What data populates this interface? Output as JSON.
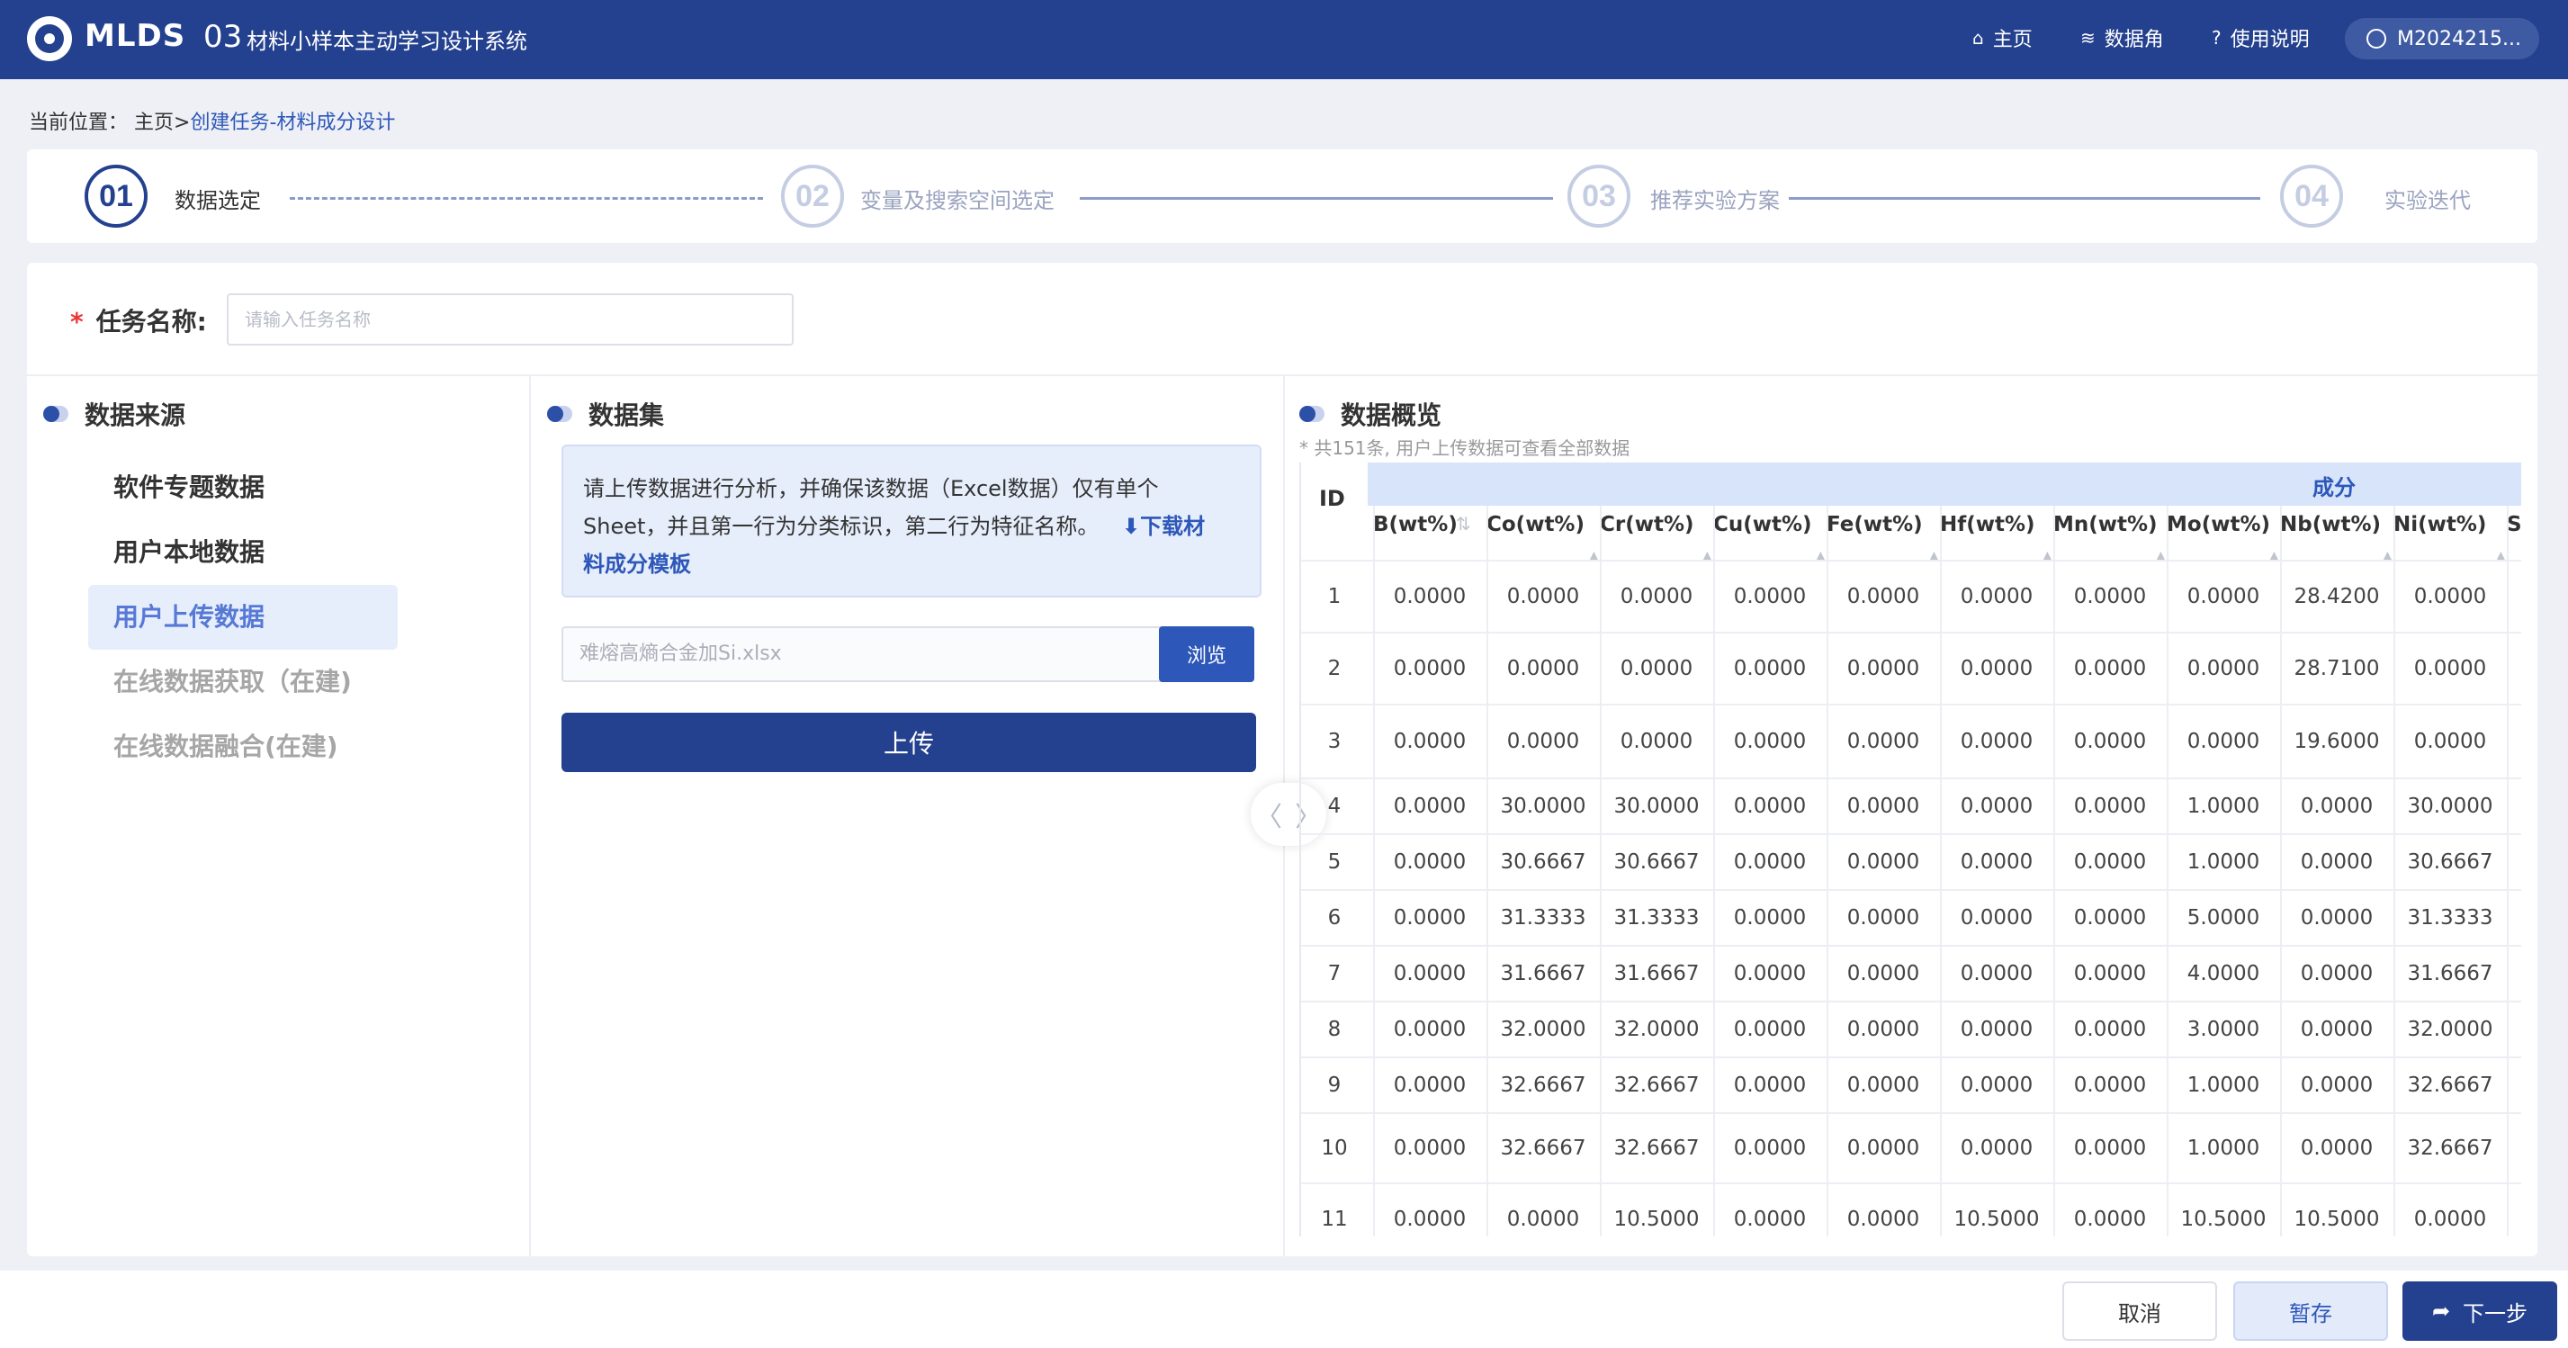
{
  "app": {
    "logo_text": "MLDS",
    "logo_num": "03",
    "title": "材料小样本主动学习设计系统"
  },
  "nav": {
    "home": "主页",
    "data_corner": "数据角",
    "help": "使用说明",
    "user": "M2024215..."
  },
  "breadcrumb": {
    "prefix": "当前位置：",
    "home": "主页>",
    "current": "创建任务-材料成分设计"
  },
  "steps": [
    {
      "num": "01",
      "label": "数据选定"
    },
    {
      "num": "02",
      "label": "变量及搜索空间选定"
    },
    {
      "num": "03",
      "label": "推荐实验方案"
    },
    {
      "num": "04",
      "label": "实验迭代"
    }
  ],
  "task": {
    "required_mark": "*",
    "label": "任务名称:",
    "placeholder": "请输入任务名称"
  },
  "data_source": {
    "title": "数据来源",
    "items": [
      {
        "label": "软件专题数据"
      },
      {
        "label": "用户本地数据"
      },
      {
        "label": "用户上传数据"
      },
      {
        "label": "在线数据获取（在建)"
      },
      {
        "label": "在线数据融合(在建)"
      }
    ]
  },
  "dataset": {
    "title": "数据集",
    "notice_line1": "请上传数据进行分析，并确保该数据（Excel数据）仅有单个",
    "notice_line2": "Sheet，并且第一行为分类标识，第二行为特征名称。",
    "download_label_1": "⬇下载材",
    "download_label_2": "料成分模板",
    "file_name": "难熔高熵合金加Si.xlsx",
    "browse_label": "浏览",
    "upload_label": "上传"
  },
  "overview": {
    "title": "数据概览",
    "note": "* 共151条, 用户上传数据可查看全部数据",
    "id_header": "ID",
    "group_header": "成分",
    "columns": [
      "B(wt%)",
      "Co(wt%)",
      "Cr(wt%)",
      "Cu(wt%)",
      "Fe(wt%)",
      "Hf(wt%)",
      "Mn(wt%)",
      "Mo(wt%)",
      "Nb(wt%)",
      "Ni(wt%)",
      "Si"
    ],
    "rows": [
      {
        "id": "1",
        "values": [
          "0.0000",
          "0.0000",
          "0.0000",
          "0.0000",
          "0.0000",
          "0.0000",
          "0.0000",
          "0.0000",
          "28.4200",
          "0.0000"
        ]
      },
      {
        "id": "2",
        "values": [
          "0.0000",
          "0.0000",
          "0.0000",
          "0.0000",
          "0.0000",
          "0.0000",
          "0.0000",
          "0.0000",
          "28.7100",
          "0.0000"
        ]
      },
      {
        "id": "3",
        "values": [
          "0.0000",
          "0.0000",
          "0.0000",
          "0.0000",
          "0.0000",
          "0.0000",
          "0.0000",
          "0.0000",
          "19.6000",
          "0.0000"
        ]
      },
      {
        "id": "4",
        "values": [
          "0.0000",
          "30.0000",
          "30.0000",
          "0.0000",
          "0.0000",
          "0.0000",
          "0.0000",
          "1.0000",
          "0.0000",
          "30.0000"
        ]
      },
      {
        "id": "5",
        "values": [
          "0.0000",
          "30.6667",
          "30.6667",
          "0.0000",
          "0.0000",
          "0.0000",
          "0.0000",
          "1.0000",
          "0.0000",
          "30.6667"
        ]
      },
      {
        "id": "6",
        "values": [
          "0.0000",
          "31.3333",
          "31.3333",
          "0.0000",
          "0.0000",
          "0.0000",
          "0.0000",
          "5.0000",
          "0.0000",
          "31.3333"
        ]
      },
      {
        "id": "7",
        "values": [
          "0.0000",
          "31.6667",
          "31.6667",
          "0.0000",
          "0.0000",
          "0.0000",
          "0.0000",
          "4.0000",
          "0.0000",
          "31.6667"
        ]
      },
      {
        "id": "8",
        "values": [
          "0.0000",
          "32.0000",
          "32.0000",
          "0.0000",
          "0.0000",
          "0.0000",
          "0.0000",
          "3.0000",
          "0.0000",
          "32.0000"
        ]
      },
      {
        "id": "9",
        "values": [
          "0.0000",
          "32.6667",
          "32.6667",
          "0.0000",
          "0.0000",
          "0.0000",
          "0.0000",
          "1.0000",
          "0.0000",
          "32.6667"
        ]
      },
      {
        "id": "10",
        "values": [
          "0.0000",
          "32.6667",
          "32.6667",
          "0.0000",
          "0.0000",
          "0.0000",
          "0.0000",
          "1.0000",
          "0.0000",
          "32.6667"
        ]
      },
      {
        "id": "11",
        "values": [
          "0.0000",
          "0.0000",
          "10.5000",
          "0.0000",
          "0.0000",
          "10.5000",
          "0.0000",
          "10.5000",
          "10.5000",
          "0.0000"
        ]
      }
    ]
  },
  "footer": {
    "cancel": "取消",
    "save": "暂存",
    "next": "下一步"
  },
  "colors": {
    "brand": "#24418f",
    "accent": "#2d57b8",
    "required": "#ee3333"
  }
}
